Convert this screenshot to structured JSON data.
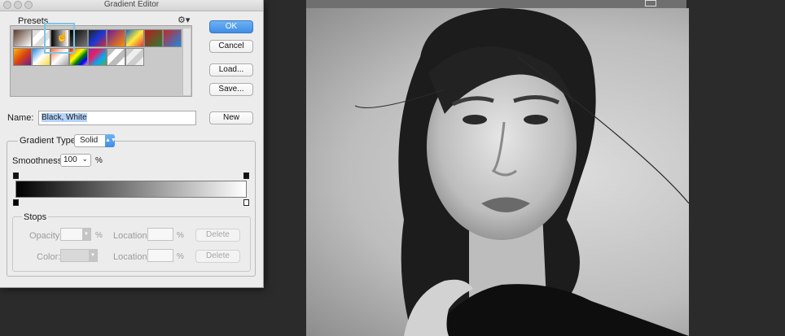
{
  "window": {
    "title": "Gradient Editor"
  },
  "presets": {
    "label": "Presets",
    "gear_icon": "gear-icon",
    "swatches_row1": [
      "linear-gradient(135deg,#5a3c2a,#fff)",
      "linear-gradient(135deg,#ddd 25%,#fff 25%,#fff 50%,#ddd 50%,#ddd 75%,#fff 75%)",
      "linear-gradient(90deg,#000,#fff)",
      "linear-gradient(135deg,#000,#777)",
      "linear-gradient(135deg,#222,#1a37d6,#d62d2d)",
      "linear-gradient(135deg,#6a1b9a,#ff8f00)",
      "linear-gradient(135deg,#1565c0,#ffeb3b,#e53935)",
      "linear-gradient(135deg,#b71c1c,#2e7d32)",
      "linear-gradient(135deg,#c62828,#1e88e5)"
    ],
    "swatches_row2": [
      "linear-gradient(135deg,#ffb300,#d84315,#6a1b9a)",
      "linear-gradient(135deg,#1e88e5,#fff,#fdd835)",
      "linear-gradient(135deg,#ff7043,#fff,#9e9e9e)",
      "linear-gradient(135deg,red,orange,yellow,green,blue,violet)",
      "linear-gradient(135deg,#9c27b0,#e91e63,#03a9f4,#4caf50)",
      "linear-gradient(135deg,#bbb 25%,#fff 25%,#fff 50%,#bbb 50%,#bbb 75%,#fff 75%)",
      "linear-gradient(135deg,#ccc 25%,#eee 25%,#eee 50%,#ccc 50%,#ccc 75%,#eee 75%)"
    ]
  },
  "buttons": {
    "ok": "OK",
    "cancel": "Cancel",
    "load": "Load...",
    "save": "Save...",
    "new": "New"
  },
  "name": {
    "label": "Name:",
    "value": "Black, White"
  },
  "gradient": {
    "type_label": "Gradient Type:",
    "type_value": "Solid",
    "smoothness_label": "Smoothness:",
    "smoothness_value": "100",
    "percent": "%"
  },
  "stops": {
    "label": "Stops",
    "opacity_label": "Opacity:",
    "color_label": "Color:",
    "location_label": "Location:",
    "percent": "%",
    "delete": "Delete"
  },
  "colors": {
    "accent": "#3e8de6",
    "selection": "#7dc6e8"
  }
}
